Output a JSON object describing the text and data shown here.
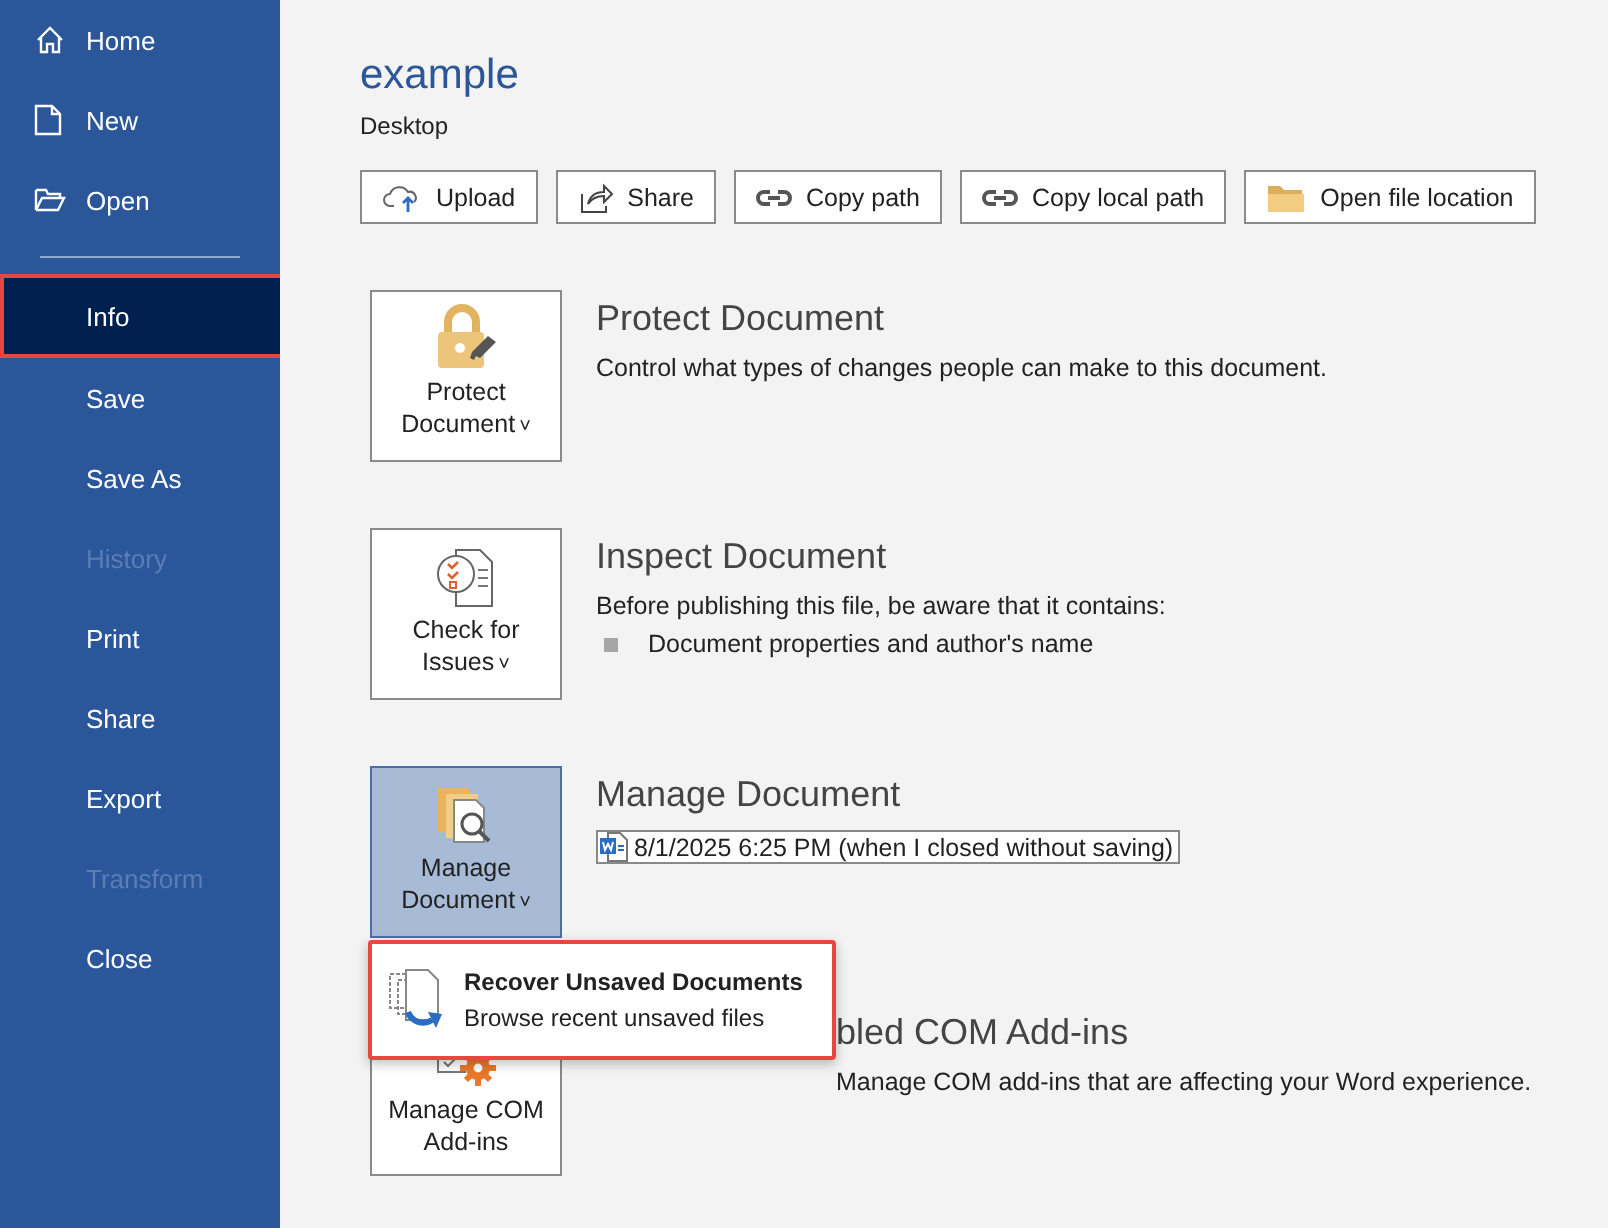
{
  "sidebar": {
    "items": [
      {
        "kind": "nav",
        "label": "Home",
        "selected": false,
        "disabled": false
      },
      {
        "kind": "nav",
        "label": "New",
        "selected": false,
        "disabled": false
      },
      {
        "kind": "nav",
        "label": "Open",
        "selected": false,
        "disabled": false
      },
      {
        "kind": "divider"
      },
      {
        "kind": "nav",
        "label": "Info",
        "selected": true,
        "disabled": false
      },
      {
        "kind": "nav",
        "label": "Save",
        "selected": false,
        "disabled": false
      },
      {
        "kind": "nav",
        "label": "Save As",
        "selected": false,
        "disabled": false
      },
      {
        "kind": "nav",
        "label": "History",
        "selected": false,
        "disabled": true
      },
      {
        "kind": "nav",
        "label": "Print",
        "selected": false,
        "disabled": false
      },
      {
        "kind": "nav",
        "label": "Share",
        "selected": false,
        "disabled": false
      },
      {
        "kind": "nav",
        "label": "Export",
        "selected": false,
        "disabled": false
      },
      {
        "kind": "nav",
        "label": "Transform",
        "selected": false,
        "disabled": true
      },
      {
        "kind": "nav",
        "label": "Close",
        "selected": false,
        "disabled": false
      }
    ]
  },
  "document": {
    "title": "example",
    "location": "Desktop"
  },
  "actions": [
    {
      "label": "Upload"
    },
    {
      "label": "Share"
    },
    {
      "label": "Copy path"
    },
    {
      "label": "Copy local path"
    },
    {
      "label": "Open file location"
    }
  ],
  "sections": [
    {
      "tile_lines": [
        "Protect",
        "Document"
      ],
      "tile_caret": "˅",
      "active": false,
      "title": "Protect Document",
      "description": "Control what types of changes people can make to this document."
    },
    {
      "tile_lines": [
        "Check for",
        "Issues"
      ],
      "tile_caret": "˅",
      "active": false,
      "title": "Inspect Document",
      "description": "Before publishing this file, be aware that it contains:",
      "bullets": [
        "Document properties and author's name"
      ]
    },
    {
      "tile_lines": [
        "Manage",
        "Document"
      ],
      "tile_caret": "˅",
      "active": true,
      "title": "Manage Document",
      "versions": [
        "8/1/2025 6:25 PM (when I closed without saving)"
      ],
      "menu": {
        "title": "Recover Unsaved Documents",
        "subtitle": "Browse recent unsaved files"
      }
    },
    {
      "tile_lines": [
        "Manage COM",
        "Add-ins"
      ],
      "active": false,
      "title": "bled COM Add-ins",
      "description": "Manage COM add-ins that are affecting your Word experience."
    }
  ]
}
